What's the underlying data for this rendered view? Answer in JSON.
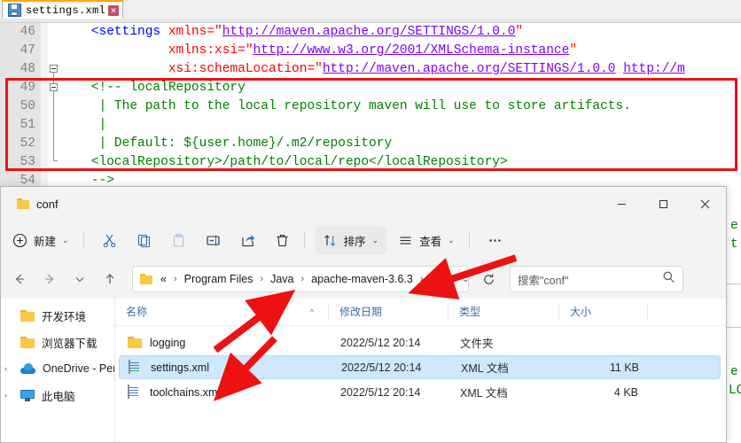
{
  "editor": {
    "tab": {
      "title": "settings.xml",
      "icon": "floppy-save-icon",
      "close_icon": "close-icon"
    },
    "lines": [
      {
        "num": "46",
        "indent": 0,
        "tokens": [
          {
            "t": "tag",
            "s": "    <settings "
          },
          {
            "t": "attr",
            "s": "xmlns="
          },
          {
            "t": "attr",
            "s": "\""
          },
          {
            "t": "val",
            "s": "http://maven.apache.org/SETTINGS/1.0.0"
          },
          {
            "t": "attr",
            "s": "\""
          }
        ]
      },
      {
        "num": "47",
        "indent": 0,
        "tokens": [
          {
            "t": "plain",
            "s": "              "
          },
          {
            "t": "attr",
            "s": "xmlns:xsi=\""
          },
          {
            "t": "val",
            "s": "http://www.w3.org/2001/XMLSchema-instance"
          },
          {
            "t": "attr",
            "s": "\""
          }
        ]
      },
      {
        "num": "48",
        "indent": 0,
        "tokens": [
          {
            "t": "plain",
            "s": "              "
          },
          {
            "t": "attr",
            "s": "xsi:schemaLocation=\""
          },
          {
            "t": "val",
            "s": "http://maven.apache.org/SETTINGS/1.0.0"
          },
          {
            "t": "attr",
            "s": " "
          },
          {
            "t": "val",
            "s": "http://m"
          }
        ]
      },
      {
        "num": "49",
        "indent": 0,
        "tokens": [
          {
            "t": "cmt",
            "s": "    <!-- localRepository"
          }
        ]
      },
      {
        "num": "50",
        "indent": 0,
        "tokens": [
          {
            "t": "cmt",
            "s": "     | The path to the local repository maven will use to store artifacts."
          }
        ]
      },
      {
        "num": "51",
        "indent": 0,
        "tokens": [
          {
            "t": "cmt",
            "s": "     |"
          }
        ]
      },
      {
        "num": "52",
        "indent": 0,
        "tokens": [
          {
            "t": "cmt",
            "s": "     | Default: ${user.home}/.m2/repository"
          }
        ]
      },
      {
        "num": "53",
        "indent": 0,
        "tokens": [
          {
            "t": "cmt",
            "s": "    <localRepository>/path/to/local/repo</localRepository>"
          }
        ]
      },
      {
        "num": "54",
        "indent": 0,
        "tokens": [
          {
            "t": "cmt",
            "s": "    -->"
          }
        ]
      }
    ],
    "background_peek": {
      "line_a": "e",
      "line_b": "t",
      "line_c": "e",
      "line_d": "LO"
    }
  },
  "explorer": {
    "window_title": "conf",
    "window_controls": {
      "minimize": "minimize-icon",
      "maximize": "maximize-icon",
      "close": "close-icon"
    },
    "toolbar": {
      "new_label": "新建",
      "sort_label": "排序",
      "view_label": "查看",
      "more_label": "…",
      "items": [
        {
          "name": "new-button",
          "icon": "plus-circle-icon",
          "label": "新建"
        },
        {
          "name": "cut-button",
          "icon": "scissors-icon",
          "label": ""
        },
        {
          "name": "copy-button",
          "icon": "copy-icon",
          "label": ""
        },
        {
          "name": "paste-button",
          "icon": "clipboard-icon",
          "label": ""
        },
        {
          "name": "rename-button",
          "icon": "rename-icon",
          "label": ""
        },
        {
          "name": "share-button",
          "icon": "share-icon",
          "label": ""
        },
        {
          "name": "delete-button",
          "icon": "trash-icon",
          "label": ""
        },
        {
          "name": "sort-button",
          "icon": "sort-arrows-icon",
          "label": "排序"
        },
        {
          "name": "view-button",
          "icon": "list-lines-icon",
          "label": "查看"
        },
        {
          "name": "more-button",
          "icon": "ellipsis-icon",
          "label": ""
        }
      ]
    },
    "address": {
      "back_icon": "back-arrow-icon",
      "forward_icon": "forward-arrow-icon",
      "recent_icon": "chevron-down-icon",
      "up_icon": "up-arrow-icon",
      "folder_icon": "folder-icon",
      "overflow": "«",
      "crumbs": [
        "Program Files",
        "Java",
        "apache-maven-3.6.3",
        "conf"
      ],
      "separator": "›",
      "dropdown_icon": "chevron-down-icon",
      "refresh_icon": "refresh-icon",
      "search_placeholder": "搜索\"conf\"",
      "search_icon": "search-icon"
    },
    "sidebar": {
      "items": [
        {
          "label": "开发环境",
          "icon": "folder-icon",
          "chevron": ""
        },
        {
          "label": "浏览器下载",
          "icon": "folder-icon",
          "chevron": ""
        },
        {
          "label": "OneDrive - Pers",
          "icon": "onedrive-icon",
          "chevron": "›"
        },
        {
          "label": "此电脑",
          "icon": "this-pc-icon",
          "chevron": "›"
        }
      ]
    },
    "columns": [
      {
        "label": "名称",
        "sort": "^"
      },
      {
        "label": "修改日期",
        "sort": ""
      },
      {
        "label": "类型",
        "sort": ""
      },
      {
        "label": "大小",
        "sort": ""
      }
    ],
    "files": [
      {
        "name": "logging",
        "icon": "folder-icon",
        "date": "2022/5/12 20:14",
        "type": "文件夹",
        "size": "",
        "selected": false
      },
      {
        "name": "settings.xml",
        "icon": "xml-file-icon",
        "date": "2022/5/12 20:14",
        "type": "XML 文档",
        "size": "11 KB",
        "selected": true
      },
      {
        "name": "toolchains.xml",
        "icon": "xml-file-icon",
        "date": "2022/5/12 20:14",
        "type": "XML 文档",
        "size": "4 KB",
        "selected": false
      }
    ]
  },
  "annotations": {
    "rect_color": "#ee1111",
    "arrow_color": "#ee1111",
    "arrows": [
      {
        "name": "arrow-to-breadcrumb-conf"
      },
      {
        "name": "arrow-to-name-column"
      },
      {
        "name": "arrow-to-settings-xml-row"
      }
    ]
  }
}
